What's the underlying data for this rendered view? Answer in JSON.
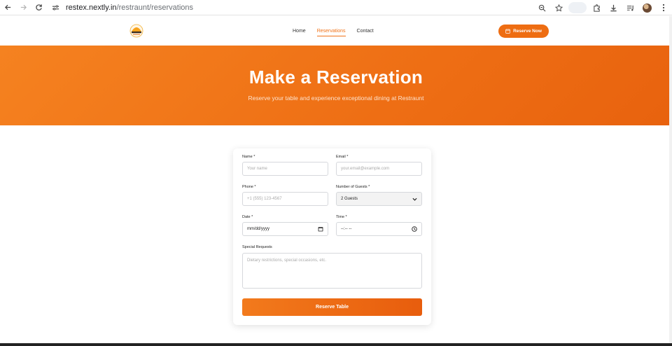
{
  "browser": {
    "url_host": "restex.nextly.in",
    "url_path": "/restraunt/reservations",
    "icons": [
      "back-arrow-icon",
      "forward-arrow-icon",
      "reload-icon",
      "site-settings-icon",
      "zoom-icon",
      "star-icon",
      "extensions-icon",
      "download-icon",
      "media-icon",
      "profile-avatar",
      "more-menu-icon"
    ]
  },
  "navbar": {
    "logo_icon": "restaurant-logo-icon",
    "items": [
      {
        "label": "Home",
        "active": false
      },
      {
        "label": "Reservations",
        "active": true
      },
      {
        "label": "Contact",
        "active": false
      }
    ],
    "cta_label": "Reserve Now",
    "cta_icon": "calendar-icon"
  },
  "hero": {
    "title": "Make a Reservation",
    "subtitle": "Reserve your table and experience exceptional dining at Restraunt"
  },
  "form": {
    "name": {
      "label": "Name *",
      "placeholder": "Your name"
    },
    "email": {
      "label": "Email *",
      "placeholder": "your.email@example.com"
    },
    "phone": {
      "label": "Phone *",
      "placeholder": "+1 (555) 123-4567"
    },
    "guests": {
      "label": "Number of Guests *",
      "value": "2 Guests"
    },
    "date": {
      "label": "Date *",
      "value": "mm/dd/yyyy"
    },
    "time": {
      "label": "Time *",
      "value": "--:-- --"
    },
    "requests": {
      "label": "Special Requests",
      "placeholder": "Dietary restrictions, special occasions, etc."
    },
    "submit_label": "Reserve Table"
  },
  "colors": {
    "accent": "#ee6d12",
    "hero_start": "#f58220",
    "hero_end": "#e8620e"
  }
}
